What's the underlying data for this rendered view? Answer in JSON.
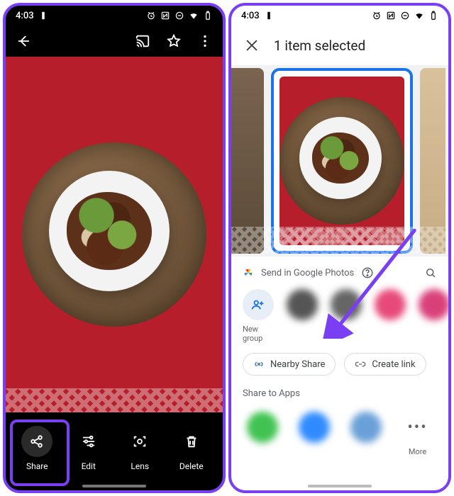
{
  "statusbar": {
    "time": "4:03"
  },
  "left": {
    "actions": {
      "share": "Share",
      "edit": "Edit",
      "lens": "Lens",
      "delete": "Delete"
    }
  },
  "right": {
    "header": {
      "title": "1 item selected"
    },
    "sheet": {
      "send_label": "Send in Google Photos",
      "new_group": "New group",
      "nearby_share": "Nearby Share",
      "create_link": "Create link",
      "share_to_apps": "Share to Apps",
      "more": "More"
    }
  }
}
